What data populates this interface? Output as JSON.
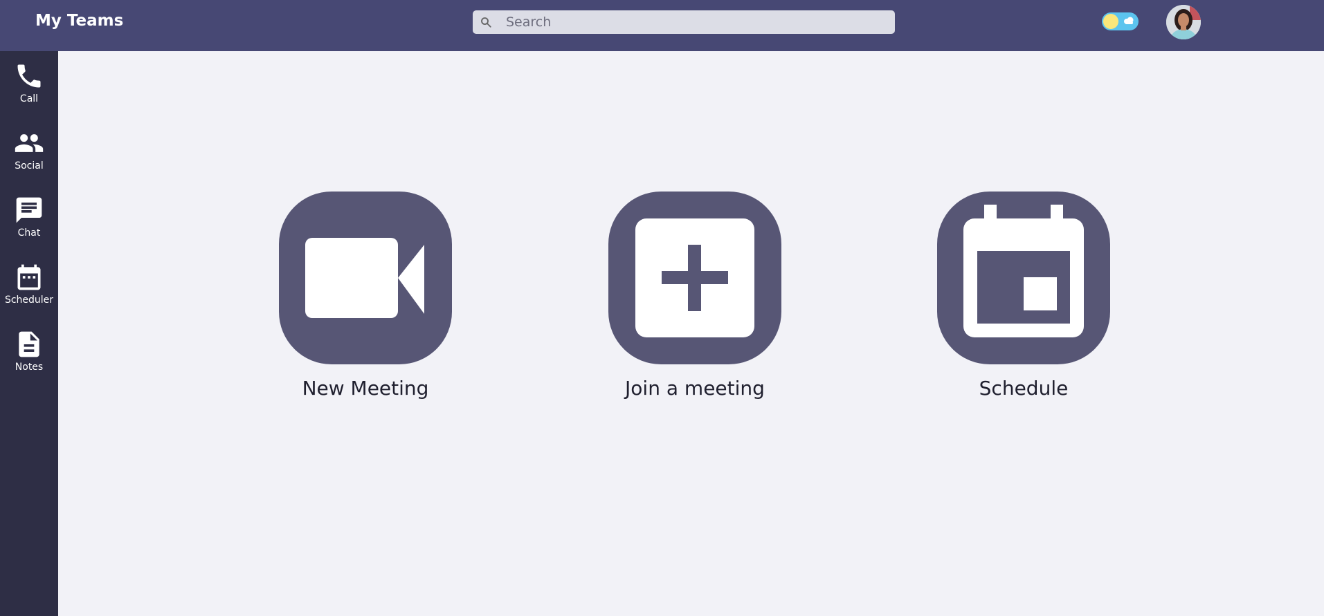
{
  "header": {
    "title": "My Teams",
    "search_placeholder": "Search",
    "search_value": ""
  },
  "sidebar": {
    "items": [
      {
        "label": "Call",
        "icon": "phone-icon"
      },
      {
        "label": "Social",
        "icon": "people-icon"
      },
      {
        "label": "Chat",
        "icon": "chat-icon"
      },
      {
        "label": "Scheduler",
        "icon": "calendar-icon"
      },
      {
        "label": "Notes",
        "icon": "document-icon"
      }
    ]
  },
  "actions": [
    {
      "label": "New Meeting",
      "icon": "video-camera-icon"
    },
    {
      "label": "Join a meeting",
      "icon": "plus-box-icon"
    },
    {
      "label": "Schedule",
      "icon": "calendar-icon"
    }
  ],
  "colors": {
    "header_bg": "#474874",
    "sidebar_bg": "#2e2e45",
    "content_bg": "#f2f2f7",
    "tile_bg": "#575675",
    "toggle_bg": "#5cc4ee",
    "sun": "#fbe77a"
  }
}
